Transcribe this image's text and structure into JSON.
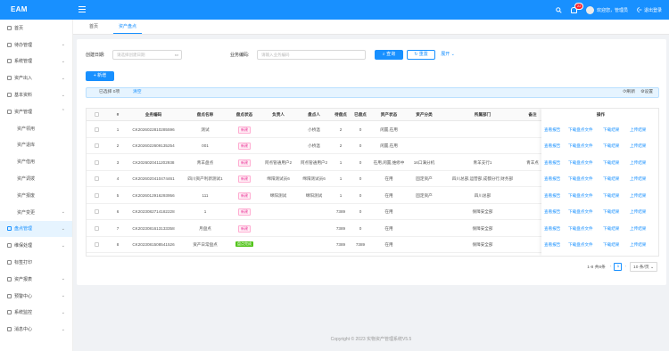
{
  "app": {
    "title": "EAM"
  },
  "header": {
    "bell_count": "22",
    "welcome": "欢迎您，管理员",
    "logout": "退出登录"
  },
  "sidebar": {
    "items": [
      {
        "label": "首页",
        "icon": "home-icon",
        "chev": ""
      },
      {
        "label": "待办管理",
        "icon": "todo-icon",
        "chev": "⌄"
      },
      {
        "label": "系统管理",
        "icon": "gear-icon",
        "chev": "⌄"
      },
      {
        "label": "资产出入",
        "icon": "transfer-icon",
        "chev": "⌄"
      },
      {
        "label": "基本资料",
        "icon": "profile-icon",
        "chev": "⌄"
      },
      {
        "label": "资产管理",
        "icon": "asset-icon",
        "chev": "⌃"
      },
      {
        "label": "资产领用",
        "sub": true
      },
      {
        "label": "资产退库",
        "sub": true
      },
      {
        "label": "资产借用",
        "sub": true
      },
      {
        "label": "资产调拨",
        "sub": true
      },
      {
        "label": "资产报废",
        "sub": true
      },
      {
        "label": "资产变更",
        "sub": true,
        "chev": "⌄"
      },
      {
        "label": "盘点管理",
        "icon": "inventory-icon",
        "chev": "⌄",
        "active": true
      },
      {
        "label": "维保处理",
        "icon": "wrench-icon",
        "chev": "⌄"
      },
      {
        "label": "标签打印",
        "icon": "tag-icon",
        "chev": ""
      },
      {
        "label": "资产报表",
        "icon": "report-icon",
        "chev": "⌄"
      },
      {
        "label": "预警中心",
        "icon": "alert-icon",
        "chev": "⌄"
      },
      {
        "label": "系统监控",
        "icon": "monitor-icon",
        "chev": "⌄"
      },
      {
        "label": "消息中心",
        "icon": "message-icon",
        "chev": "⌄"
      }
    ]
  },
  "tabs": [
    {
      "label": "首页"
    },
    {
      "label": "资产盘点",
      "active": true
    }
  ],
  "filters": {
    "date_label": "创建日期:",
    "date_placeholder": "请选择创建日期",
    "code_label": "业务编码:",
    "code_placeholder": "请输入业务编码",
    "search": "查询",
    "reset": "重置",
    "expand": "展开"
  },
  "toolbar": {
    "add": "+ 新增"
  },
  "selection": {
    "selected": "已选择 0项",
    "clear": "清空",
    "refresh": "刷新",
    "settings": "设置"
  },
  "table": {
    "columns": [
      "#",
      "业务编码",
      "盘点名称",
      "盘点状态",
      "负责人",
      "盘点人",
      "待盘点",
      "已盘点",
      "资产状态",
      "资产分类",
      "所属部门",
      "备注"
    ],
    "ops_header": "操作",
    "ops": [
      "查看报告",
      "下载盘点文件",
      "下载结果",
      "上传结果"
    ],
    "rows": [
      [
        "1",
        "CK2026022810285596",
        "测试",
        "新建",
        "",
        "小桥温",
        "2",
        "0",
        "闲置,在用",
        "",
        "",
        ""
      ],
      [
        "2",
        "CK2026022609135254",
        "001",
        "新建",
        "",
        "小桥温",
        "2",
        "0",
        "闲置,在用",
        "",
        "",
        ""
      ],
      [
        "3",
        "CK2026020411202938",
        "青羊盘点",
        "新建",
        "阿点管通用户2",
        "阿点管通用户2",
        "1",
        "0",
        "在用,闲置,维修中",
        "16口满分机",
        "青羊支行1",
        "青羊点"
      ],
      [
        "4",
        "CK2026020410474461",
        "四川资产利新测试1",
        "新建",
        "绵阳测试员6",
        "绵阳测试员6",
        "1",
        "0",
        "在用",
        "固定资产",
        "四川总部,运营部,成都分行,财务部",
        ""
      ],
      [
        "5",
        "CK2026012916293956",
        "111",
        "新建",
        "绵阳测试",
        "绵阳测试",
        "1",
        "0",
        "在用",
        "固定资产",
        "四川总部",
        ""
      ],
      [
        "6",
        "CK2023082714182228",
        "1",
        "新建",
        "",
        "",
        "7389",
        "0",
        "在用",
        "",
        "保障安全部",
        ""
      ],
      [
        "7",
        "CK2023081613133358",
        "月盘点",
        "新建",
        "",
        "",
        "7389",
        "0",
        "在用",
        "",
        "保障安全部",
        ""
      ],
      [
        "8",
        "CK2023081508541526",
        "资产日常盘点",
        "盘点完成",
        "",
        "",
        "7389",
        "7389",
        "在用",
        "",
        "保障安全部",
        ""
      ]
    ]
  },
  "pagination": {
    "summary": "1-8 共8条",
    "prev": "‹",
    "page": "1",
    "next": "›",
    "size": "10 条/页 ⌄"
  },
  "footer": {
    "text": "Copyright © 2023 实物资产管理系统V5.5"
  },
  "colors": {
    "primary": "#1890ff",
    "new_tag": "#eb2f96",
    "done_tag": "#52c41a"
  }
}
